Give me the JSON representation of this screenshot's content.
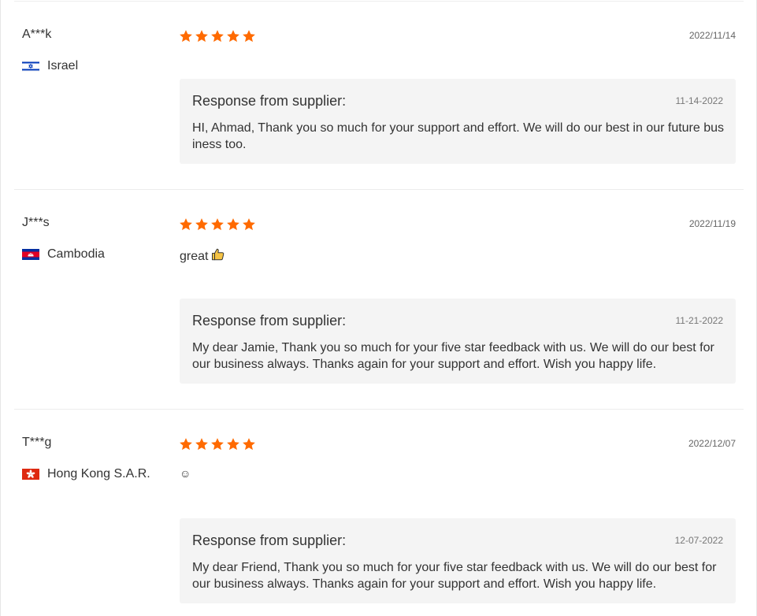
{
  "reviews": [
    {
      "buyer": "A***k",
      "country": "Israel",
      "flag_icon": "israel-flag-icon",
      "rating": 5,
      "date": "2022/11/14",
      "text": "",
      "response": {
        "title": "Response from supplier:",
        "date": "11-14-2022",
        "text": "HI, Ahmad, Thank you so much for your support and effort. We will do our best in our future business too."
      }
    },
    {
      "buyer": "J***s",
      "country": "Cambodia",
      "flag_icon": "cambodia-flag-icon",
      "rating": 5,
      "date": "2022/11/19",
      "text": "great",
      "text_icon": "thumbs-up-icon",
      "response": {
        "title": "Response from supplier:",
        "date": "11-21-2022",
        "text": "My dear Jamie, Thank you so much for your five star feedback with us. We will do our best for our business always. Thanks again for your support and effort. Wish you happy life."
      }
    },
    {
      "buyer": "T***g",
      "country": "Hong Kong S.A.R.",
      "flag_icon": "hong-kong-flag-icon",
      "rating": 5,
      "date": "2022/12/07",
      "text": "☺",
      "response": {
        "title": "Response from supplier:",
        "date": "12-07-2022",
        "text": "My dear Friend, Thank you so much for your five star feedback with us. We will do our best for our business always. Thanks again for your support and effort. Wish you happy life."
      }
    }
  ],
  "colors": {
    "star": "#ff6a00",
    "response_bg": "#f4f4f4",
    "text": "#333333",
    "muted": "#666666"
  }
}
